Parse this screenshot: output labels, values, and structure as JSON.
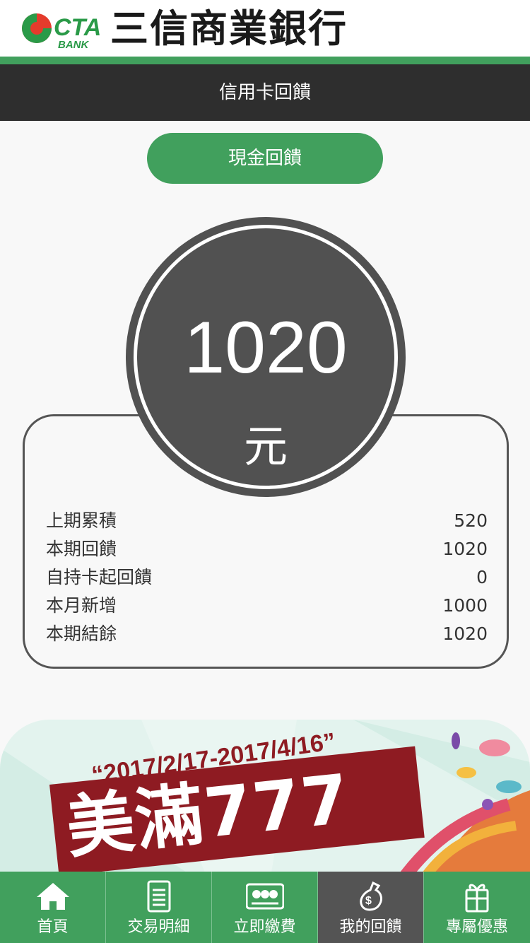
{
  "header": {
    "logo_letters": "CTA",
    "logo_sub": "BANK",
    "bank_name": "三信商業銀行",
    "page_title": "信用卡回饋",
    "brand_color": "#41a05d"
  },
  "rebate_type_button": "現金回饋",
  "balance": {
    "amount": "1020",
    "unit": "元"
  },
  "summary": {
    "rows": [
      {
        "label": "上期累積",
        "value": "520"
      },
      {
        "label": "本期回饋",
        "value": "1020"
      },
      {
        "label": "自持卡起回饋",
        "value": "0"
      },
      {
        "label": "本月新增",
        "value": "1000"
      },
      {
        "label": "本期結餘",
        "value": "1020"
      }
    ]
  },
  "promo": {
    "date_range": "“2017/2/17-2017/4/16”",
    "headline": "美滿777"
  },
  "bottom_nav": {
    "active_index": 3,
    "items": [
      {
        "label": "首頁",
        "icon": "home-icon"
      },
      {
        "label": "交易明細",
        "icon": "receipt-icon"
      },
      {
        "label": "立即繳費",
        "icon": "payment-card-icon"
      },
      {
        "label": "我的回饋",
        "icon": "money-bag-icon"
      },
      {
        "label": "專屬優惠",
        "icon": "gift-icon"
      }
    ]
  }
}
